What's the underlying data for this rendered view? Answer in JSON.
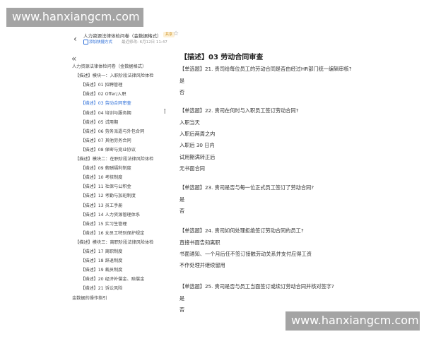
{
  "watermark": "www.hanxiangcm.com",
  "header": {
    "back_icon": "‹",
    "title": "人力资源法律体检问卷（金数据格式）",
    "tag": "共享",
    "star_icon": "☆",
    "subscribe_label": "添加快捷方式",
    "last_modified": "最近修改: 6月12日 11:47"
  },
  "sidebar": {
    "collapse_icon": "«",
    "items": [
      {
        "label": "人力资源法律体检问卷（金数据格式）",
        "active": false
      },
      {
        "label": "【描述】模块一：入职阶段法律风险体检",
        "active": false
      },
      {
        "label": "【描述】01 招聘管理",
        "active": false
      },
      {
        "label": "【描述】02 Offer/入职",
        "active": false
      },
      {
        "label": "【描述】03 劳动合同审查",
        "active": true
      },
      {
        "label": "【描述】04 培训与服务期",
        "active": false
      },
      {
        "label": "【描述】05 试用期",
        "active": false
      },
      {
        "label": "【描述】06 劳务派遣与外包合同",
        "active": false
      },
      {
        "label": "【描述】07 其他劳务合同",
        "active": false
      },
      {
        "label": "【描述】08 保密与竞业协议",
        "active": false
      },
      {
        "label": "【描述】模块二：在职阶段法律风险体检",
        "active": false
      },
      {
        "label": "【描述】09 薪酬福利制度",
        "active": false
      },
      {
        "label": "【描述】10 考核制度",
        "active": false
      },
      {
        "label": "【描述】11 社保与公积金",
        "active": false
      },
      {
        "label": "【描述】12 考勤与加班制度",
        "active": false
      },
      {
        "label": "【描述】13 员工手册",
        "active": false
      },
      {
        "label": "【描述】14 人力资源管理体系",
        "active": false
      },
      {
        "label": "【描述】15 实习生管理",
        "active": false
      },
      {
        "label": "【描述】16 女员工特别保护规定",
        "active": false
      },
      {
        "label": "【描述】模块三：离职阶段法律风险体检",
        "active": false
      },
      {
        "label": "【描述】17 离职制度",
        "active": false
      },
      {
        "label": "【描述】18 辞退制度",
        "active": false
      },
      {
        "label": "【描述】19 裁员制度",
        "active": false
      },
      {
        "label": "【描述】20 经济补偿金、赔偿金",
        "active": false
      },
      {
        "label": "【描述】21 诉讼风险",
        "active": false
      },
      {
        "label": "金数据的操作指引",
        "active": false
      }
    ]
  },
  "main": {
    "title": "【描述】03 劳动合同审查",
    "questions": [
      {
        "text": "【单选题】21. 贵司给每位员工的劳动合同是否由经过HR部门统一编辑审核?",
        "options": [
          "是",
          "否"
        ]
      },
      {
        "text": "【单选题】22. 贵司在何时与入职员工签订劳动合同?",
        "options": [
          "入职当天",
          "入职后两周之内",
          "入职后 30 日内",
          "试用期满转正后",
          "无书面合同"
        ]
      },
      {
        "text": "【单选题】23. 贵司是否与每一位正式员工签订了劳动合同?",
        "options": [
          "是",
          "否"
        ]
      },
      {
        "text": "【单选题】24. 贵司如何处理拒绝签订劳动合同的员工?",
        "options": [
          "直接书面告知离职",
          "书面通知、一个月后任不签订接触劳动关系并支付应得工资",
          "不作处理并继续留用"
        ]
      },
      {
        "text": "【单选题】25. 贵司是否与员工当面签订或续订劳动合同并核对签字?",
        "options": [
          "是",
          "否"
        ]
      }
    ]
  },
  "colors": {
    "accent": "#2e6fd8",
    "tag_text": "#c98a12",
    "tag_bg": "#fdf0d6"
  }
}
